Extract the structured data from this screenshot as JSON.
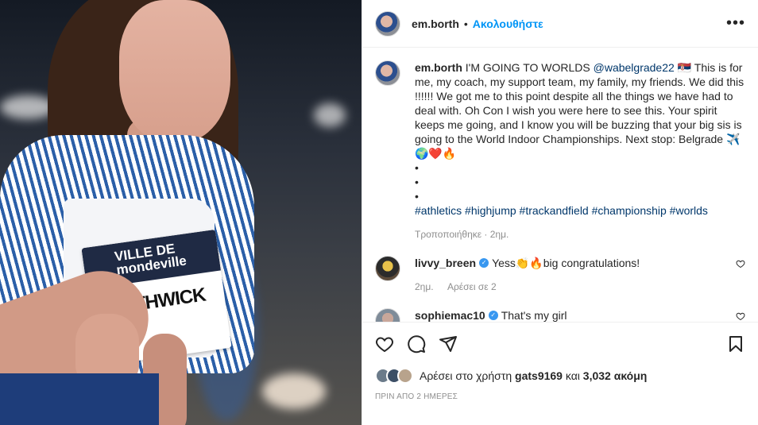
{
  "header": {
    "username": "em.borth",
    "separator": "•",
    "follow_label": "Ακολουθήστε",
    "more_label": "•••"
  },
  "caption": {
    "username": "em.borth",
    "text_start": "I'M GOING TO WORLDS",
    "mention": "@wabelgrade22",
    "flag": "🇷🇸",
    "text_main": "This is for me, my coach, my support team, my family, my friends. We did this !!!!!! We got me to this point despite all the things we have had to deal with. Oh Con I wish you were here to see this. Your spirit keeps me going, and I know you will be buzzing that your big sis is going to the World Indoor Championships. Next stop: Belgrade",
    "emojis": "✈️🌍❤️🔥",
    "bullets": [
      "•",
      "•",
      "•"
    ],
    "hashtags": [
      "#athletics",
      "#highjump",
      "#trackandfield",
      "#championship",
      "#worlds"
    ],
    "edited": "Τροποποιήθηκε · 2ημ."
  },
  "comments": [
    {
      "username": "livvy_breen",
      "verified": true,
      "text": "Yess👏🔥big congratulations!",
      "age": "2ημ.",
      "likes": "Αρέσει σε 2"
    },
    {
      "username": "sophiemac10",
      "verified": true,
      "text": "That's my girl",
      "age": "",
      "likes": ""
    }
  ],
  "photo": {
    "bib_brand": "VILLE DE mondeville",
    "bib_name": "NORTHWICK"
  },
  "likes": {
    "prefix": "Αρέσει στο χρήστη",
    "user": "gats9169",
    "middle": "και",
    "count": "3,032 ακόμη"
  },
  "timestamp": "ΠΡΙΝ ΑΠΟ 2 ΗΜΕΡΕΣ",
  "colors": {
    "accent": "#0095f6",
    "link": "#00376b",
    "muted": "#8e8e8e"
  }
}
